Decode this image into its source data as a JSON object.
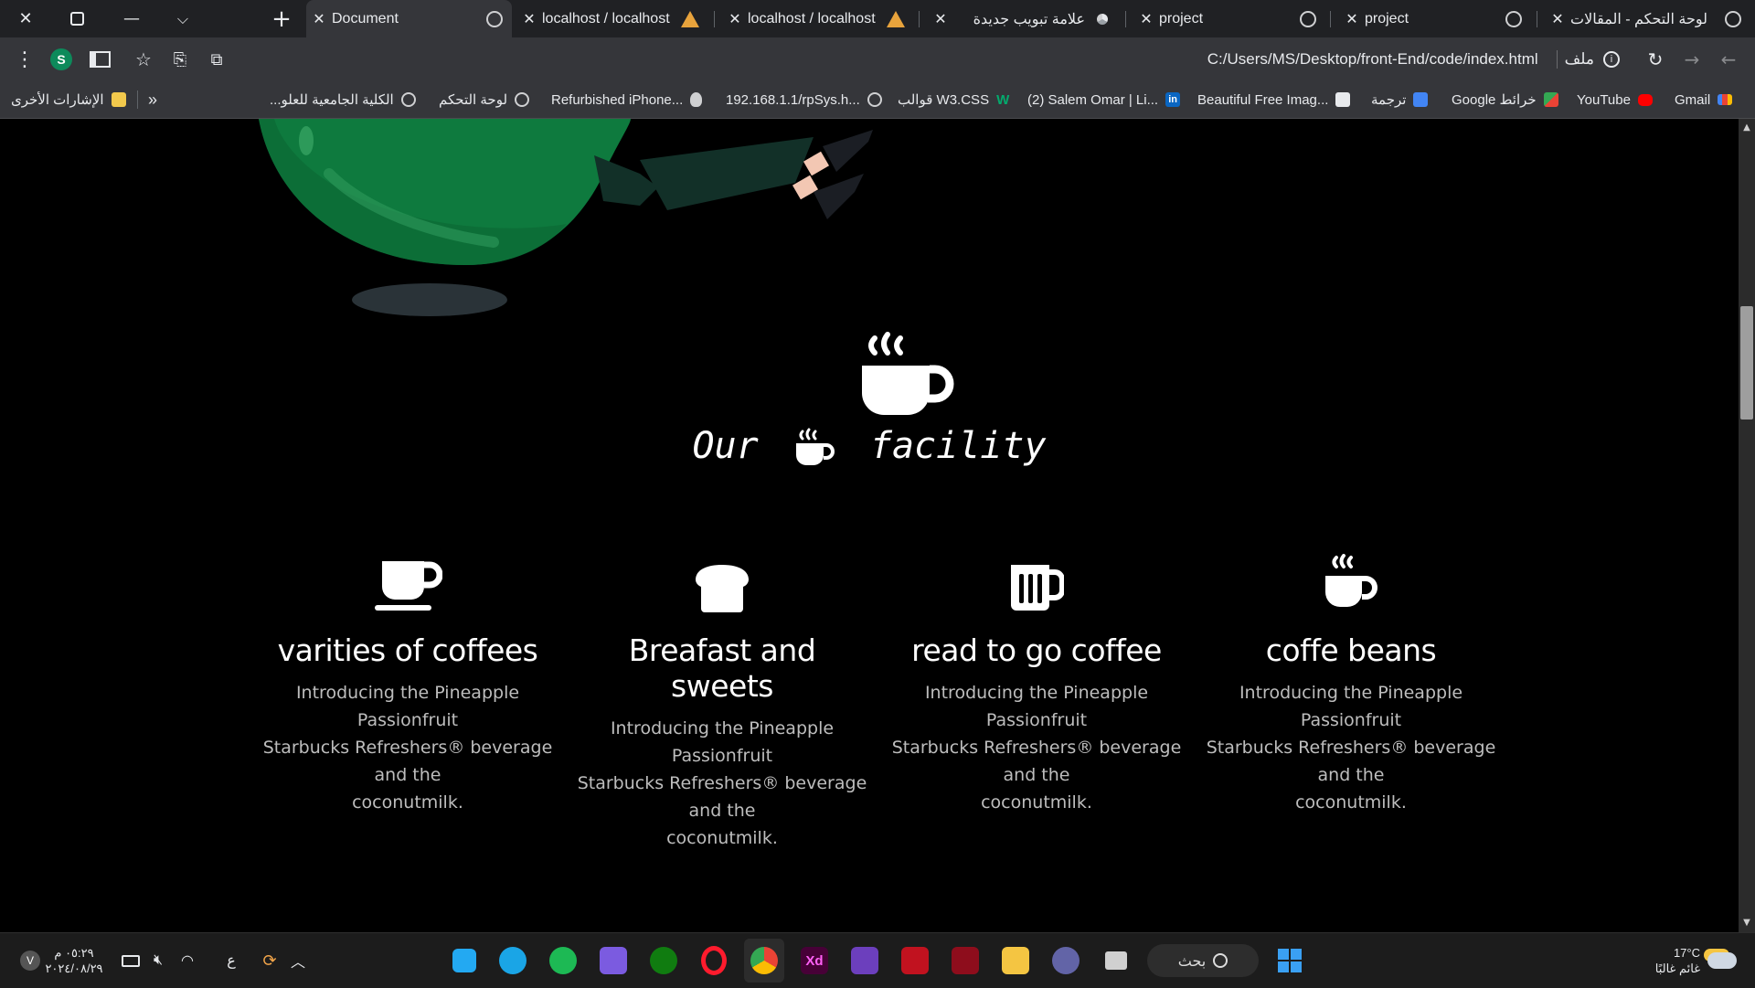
{
  "tabs": [
    {
      "title": "Document",
      "active": true
    },
    {
      "title": "localhost / localhost |",
      "active": false
    },
    {
      "title": "localhost / localhost /",
      "active": false
    },
    {
      "title": "علامة تبويب جديدة",
      "active": false
    },
    {
      "title": "project",
      "active": false
    },
    {
      "title": "project",
      "active": false
    },
    {
      "title": "لوحة التحكم - المقالات",
      "active": false
    }
  ],
  "toolbar": {
    "url": "C:/Users/MS/Desktop/front-End/code/index.html",
    "url_prefix": "ملف",
    "profile_initial": "S"
  },
  "bookmarks": [
    {
      "label": "Gmail",
      "icon": "gmail-icon",
      "color": "#ea4335"
    },
    {
      "label": "YouTube",
      "icon": "youtube-icon",
      "color": "#ff0000"
    },
    {
      "label": "خرائط Google",
      "icon": "maps-icon",
      "color": "#34a853"
    },
    {
      "label": "ترجمة",
      "icon": "translate-icon",
      "color": "#4285f4"
    },
    {
      "label": "Beautiful Free Imag...",
      "icon": "unsplash-icon",
      "color": "#ffffff"
    },
    {
      "label": "(2) Salem Omar | Li...",
      "icon": "linkedin-icon",
      "color": "#0a66c2"
    },
    {
      "label": "قوالب W3.CSS",
      "icon": "w3-icon",
      "color": "#04aa6d"
    },
    {
      "label": "192.168.1.1/rpSys.h...",
      "icon": "globe-icon",
      "color": "#cfd0d2"
    },
    {
      "label": "Refurbished iPhone...",
      "icon": "apple-icon",
      "color": "#cfd0d2"
    },
    {
      "label": "لوحة التحكم",
      "icon": "globe-icon",
      "color": "#cfd0d2"
    },
    {
      "label": "الكلية الجامعية للعلو...",
      "icon": "globe-icon",
      "color": "#cfd0d2"
    }
  ],
  "bookmarks_more": "»",
  "bookmarks_other": "الإشارات الأخرى",
  "section": {
    "heading_left": "Our",
    "heading_right": "facility"
  },
  "cards": [
    {
      "icon": "coffee-cup-icon",
      "title": "varities of coffees",
      "lines": [
        "Introducing the Pineapple",
        "Passionfruit",
        "Starbucks Refreshers® beverage",
        "and the",
        "coconutmilk."
      ]
    },
    {
      "icon": "bread-icon",
      "title": "Breafast and sweets",
      "lines": [
        "Introducing the Pineapple",
        "Passionfruit",
        "Starbucks Refreshers® beverage",
        "and the",
        "coconutmilk."
      ]
    },
    {
      "icon": "beer-mug-icon",
      "title": "read to go coffee",
      "lines": [
        "Introducing the Pineapple",
        "Passionfruit",
        "Starbucks Refreshers® beverage",
        "and the",
        "coconutmilk."
      ]
    },
    {
      "icon": "hot-mug-icon",
      "title": "coffe beans",
      "lines": [
        "Introducing the Pineapple",
        "Passionfruit",
        "Starbucks Refreshers® beverage",
        "and the",
        "coconutmilk."
      ]
    }
  ],
  "taskbar": {
    "weather_temp": "17°C",
    "weather_desc": "غائم غالبًا",
    "search_label": "بحث",
    "time": "٠٥:٢٩ م",
    "date": "٢٠٢٤/٠٨/٢٩",
    "lang": "ع",
    "user_badge": "V"
  },
  "colors": {
    "page_bg": "#000000",
    "illustration_green": "#0e7a3e",
    "text_muted": "#bdbdbd"
  }
}
